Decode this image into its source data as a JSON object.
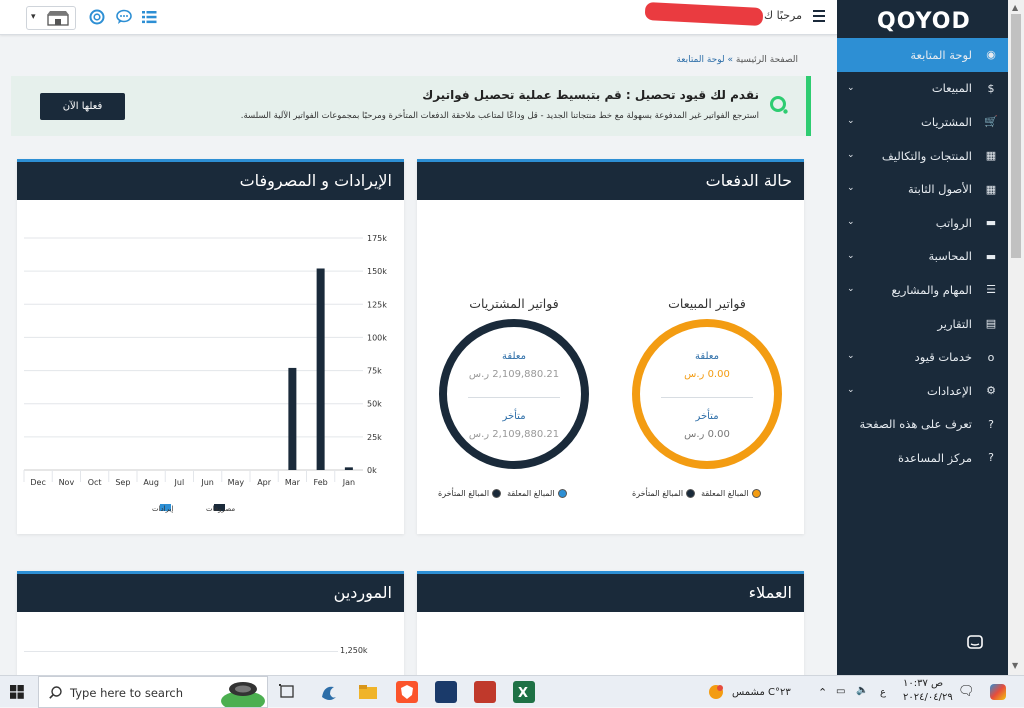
{
  "header": {
    "greeting": "مرحبًا ك",
    "store_icon": "store-icon",
    "help_icon": "lifebuoy-icon",
    "chat_icon": "chat-icon",
    "list_icon": "list-icon",
    "menu_icon": "hamburger-icon"
  },
  "sidebar": {
    "logo": "QOYOD",
    "items": [
      {
        "label": "لوحة المتابعة",
        "icon": "dashboard-icon",
        "glyph": "◉",
        "expandable": false,
        "active": true
      },
      {
        "label": "المبيعات",
        "icon": "dollar-icon",
        "glyph": "$",
        "expandable": true
      },
      {
        "label": "المشتريات",
        "icon": "cart-icon",
        "glyph": "🛒",
        "expandable": true
      },
      {
        "label": "المنتجات والتكاليف",
        "icon": "grid-icon",
        "glyph": "▦",
        "expandable": true
      },
      {
        "label": "الأصول الثابتة",
        "icon": "grid-icon",
        "glyph": "▦",
        "expandable": true
      },
      {
        "label": "الرواتب",
        "icon": "folder-icon",
        "glyph": "▬",
        "expandable": true
      },
      {
        "label": "المحاسبة",
        "icon": "folder-icon",
        "glyph": "▬",
        "expandable": true
      },
      {
        "label": "المهام والمشاريع",
        "icon": "list-icon",
        "glyph": "☰",
        "expandable": true
      },
      {
        "label": "التقارير",
        "icon": "file-icon",
        "glyph": "▤",
        "expandable": false
      },
      {
        "label": "خدمات قيود",
        "icon": "qoyod-o-icon",
        "glyph": "o",
        "expandable": true
      },
      {
        "label": "الإعدادات",
        "icon": "gear-icon",
        "glyph": "⚙",
        "expandable": true
      },
      {
        "label": "تعرف على هذه الصفحة",
        "icon": "question-icon",
        "glyph": "?",
        "expandable": false
      },
      {
        "label": "مركز المساعدة",
        "icon": "help-center-icon",
        "glyph": "?",
        "expandable": false
      }
    ]
  },
  "breadcrumb": {
    "home": "الصفحة الرئيسية",
    "sep": "»",
    "current": "لوحة المتابعة"
  },
  "promo": {
    "title": "نقدم لك قيود تحصيل : قم بتبسيط عملية تحصيل فواتيرك",
    "subtitle": "استرجع الفواتير غير المدفوعة بسهولة مع خط منتجاتنا الجديد - قل وداعًا لمتاعب ملاحقة الدفعات المتأخرة ومرحبًا بمجموعات الفواتير الآلية السلسة.",
    "button": "فعلها الآن"
  },
  "payments": {
    "title": "حالة الدفعات",
    "sales": {
      "title": "فواتير المبيعات",
      "pending_label": "معلقة",
      "pending_value": "0.00 ر.س",
      "overdue_label": "متأخر",
      "overdue_value": "0.00 ر.س",
      "color": "#f39c12",
      "legend_pending": "المبالغ المعلقة",
      "legend_overdue": "المبالغ المتأخرة"
    },
    "purchases": {
      "title": "فواتير المشتريات",
      "pending_label": "معلقة",
      "pending_value": "2,109,880.21 ر.س",
      "overdue_label": "متأخر",
      "overdue_value": "2,109,880.21 ر.س",
      "color": "#1a2a3a",
      "legend_pending": "المبالغ المعلقة",
      "legend_overdue": "المبالغ المتأخرة"
    }
  },
  "revenue_panel": {
    "title": "الإيرادات و المصروفات"
  },
  "chart_data": {
    "type": "bar",
    "categories": [
      "Dec",
      "Nov",
      "Oct",
      "Sep",
      "Aug",
      "Jul",
      "Jun",
      "May",
      "Apr",
      "Mar",
      "Feb",
      "Jan"
    ],
    "series": [
      {
        "name": "مصروفات",
        "values": [
          0,
          0,
          0,
          0,
          0,
          0,
          0,
          0,
          0,
          77000,
          152000,
          2000
        ],
        "color": "#1a2a3a"
      },
      {
        "name": "إيرادات",
        "values": [
          0,
          0,
          0,
          0,
          0,
          0,
          0,
          0,
          0,
          0,
          0,
          0
        ],
        "color": "#2d8fd4"
      }
    ],
    "yticks": [
      "0k",
      "25k",
      "50k",
      "75k",
      "100k",
      "125k",
      "150k",
      "175k"
    ],
    "ylim": [
      0,
      175000
    ],
    "grid": true,
    "legend": "bottom",
    "title": "",
    "xlabel": "",
    "ylabel": ""
  },
  "customers_panel": {
    "title": "العملاء"
  },
  "suppliers_panel": {
    "title": "الموردين",
    "first_tick": "1,250k"
  },
  "taskbar": {
    "search_placeholder": "Type here to search",
    "weather": "٢٣°C مشمس",
    "lang": "ع",
    "time": "ص ١٠:٣٧",
    "date": "٢٠٢٤/٠٤/٢٩"
  }
}
